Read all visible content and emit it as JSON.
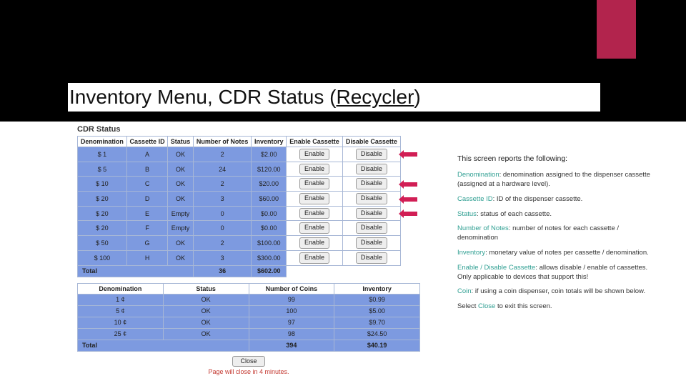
{
  "slide": {
    "title_pre": "Inventory Menu, CDR Status (",
    "title_under": "Recycler",
    "title_post": ")"
  },
  "panel": {
    "title": "CDR Status",
    "close_btn": "Close",
    "footer_note": "Page will close in 4 minutes."
  },
  "notes_table": {
    "headers": [
      "Denomination",
      "Cassette ID",
      "Status",
      "Number of Notes",
      "Inventory",
      "Enable Cassette",
      "Disable Cassette"
    ],
    "rows": [
      {
        "denom": "$ 1",
        "cid": "A",
        "status": "OK",
        "num": "2",
        "inv": "$2.00",
        "en": "Enable",
        "dis": "Disable"
      },
      {
        "denom": "$ 5",
        "cid": "B",
        "status": "OK",
        "num": "24",
        "inv": "$120.00",
        "en": "Enable",
        "dis": "Disable"
      },
      {
        "denom": "$ 10",
        "cid": "C",
        "status": "OK",
        "num": "2",
        "inv": "$20.00",
        "en": "Enable",
        "dis": "Disable"
      },
      {
        "denom": "$ 20",
        "cid": "D",
        "status": "OK",
        "num": "3",
        "inv": "$60.00",
        "en": "Enable",
        "dis": "Disable"
      },
      {
        "denom": "$ 20",
        "cid": "E",
        "status": "Empty",
        "num": "0",
        "inv": "$0.00",
        "en": "Enable",
        "dis": "Disable"
      },
      {
        "denom": "$ 20",
        "cid": "F",
        "status": "Empty",
        "num": "0",
        "inv": "$0.00",
        "en": "Enable",
        "dis": "Disable"
      },
      {
        "denom": "$ 50",
        "cid": "G",
        "status": "OK",
        "num": "2",
        "inv": "$100.00",
        "en": "Enable",
        "dis": "Disable"
      },
      {
        "denom": "$ 100",
        "cid": "H",
        "status": "OK",
        "num": "3",
        "inv": "$300.00",
        "en": "Enable",
        "dis": "Disable"
      }
    ],
    "total": {
      "label": "Total",
      "num": "36",
      "inv": "$602.00"
    }
  },
  "coins_table": {
    "headers": [
      "Denomination",
      "Status",
      "Number of Coins",
      "Inventory"
    ],
    "rows": [
      {
        "denom": "1 ¢",
        "status": "OK",
        "num": "99",
        "inv": "$0.99"
      },
      {
        "denom": "5 ¢",
        "status": "OK",
        "num": "100",
        "inv": "$5.00"
      },
      {
        "denom": "10 ¢",
        "status": "OK",
        "num": "97",
        "inv": "$9.70"
      },
      {
        "denom": "25 ¢",
        "status": "OK",
        "num": "98",
        "inv": "$24.50"
      }
    ],
    "total": {
      "label": "Total",
      "num": "394",
      "inv": "$40.19"
    }
  },
  "desc": {
    "intro": "This screen reports the following:",
    "items": [
      {
        "term": "Denomination",
        "text": ": denomination assigned to the dispenser cassette (assigned at a hardware level)."
      },
      {
        "term": "Cassette ID",
        "text": ": ID of the dispenser cassette."
      },
      {
        "term": "Status",
        "text": ": status of each cassette."
      },
      {
        "term": "Number of Notes",
        "text": ": number of notes for each cassette / denomination"
      },
      {
        "term": "Inventory",
        "text": ": monetary value of notes per cassette / denomination."
      },
      {
        "term": "Enable / Disable Cassette",
        "text": ": allows disable / enable of cassettes. Only applicable to devices that support this!"
      },
      {
        "term": "Coin",
        "text": ": if using a coin dispenser, coin totals will be shown below."
      }
    ],
    "close_pre": "Select ",
    "close_term": "Close",
    "close_post": " to exit this screen."
  }
}
